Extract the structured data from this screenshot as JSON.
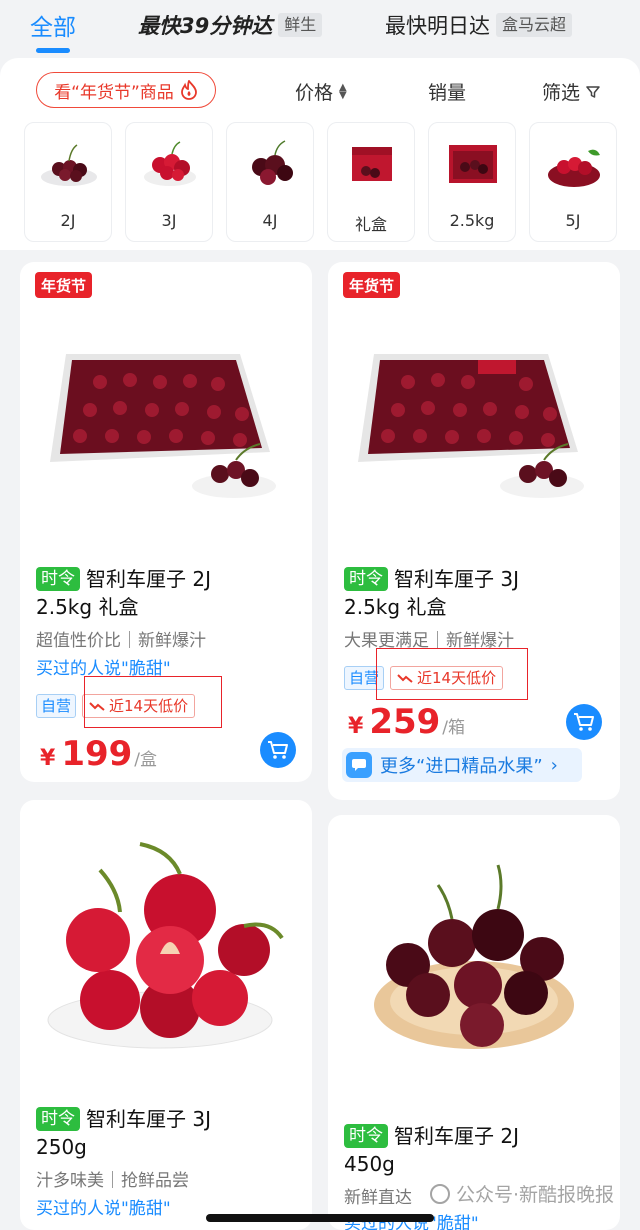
{
  "tabs": {
    "all": "全部",
    "fast": "最快39分钟达",
    "fast_tag": "鲜生",
    "next_day": "最快明日达",
    "next_day_tag": "盒马云超"
  },
  "filters": {
    "promo": "看“年货节”商品",
    "price": "价格",
    "sales": "销量",
    "filter": "筛选"
  },
  "categories": [
    "2J",
    "3J",
    "4J",
    "礼盒",
    "2.5kg",
    "5J"
  ],
  "products": [
    {
      "badge": "年货节",
      "tag": "时令",
      "title1": "智利车厘子 2J",
      "title2": "2.5kg 礼盒",
      "subtitle": "超值性价比｜新鲜爆汁",
      "buyers": "买过的人说\"脆甜\"",
      "self": "自营",
      "low": "近14天低价",
      "price_symbol": "¥",
      "price": "199",
      "unit": "/盒"
    },
    {
      "badge": "年货节",
      "tag": "时令",
      "title1": "智利车厘子 3J",
      "title2": "2.5kg 礼盒",
      "subtitle": "大果更满足｜新鲜爆汁",
      "self": "自营",
      "low": "近14天低价",
      "price_symbol": "¥",
      "price": "259",
      "unit": "/箱",
      "more": "更多“进口精品水果”"
    },
    {
      "tag": "时令",
      "title1": "智利车厘子 3J",
      "title2": "250g",
      "subtitle": "汁多味美｜抢鲜品尝",
      "buyers": "买过的人说\"脆甜\""
    },
    {
      "tag": "时令",
      "title1": "智利车厘子 2J",
      "title2": "450g",
      "subtitle": "新鲜直达",
      "buyers": "买过的人说\"脆甜\""
    }
  ],
  "watermark": "公众号·新酷报晚报",
  "colors": {
    "accent_blue": "#1a8cff",
    "price_red": "#e8232a",
    "seasonal_green": "#2dbd3f"
  }
}
